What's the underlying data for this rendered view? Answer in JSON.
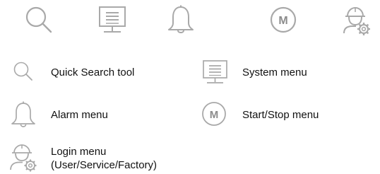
{
  "toolbar": {
    "icons": [
      "search-icon",
      "system-menu-icon",
      "alarm-bell-icon",
      "start-stop-m-icon",
      "login-user-gear-icon"
    ],
    "m_glyph": "M"
  },
  "legend": {
    "quick_search": "Quick Search tool",
    "system_menu": "System menu",
    "alarm_menu": "Alarm menu",
    "start_stop_menu": "Start/Stop menu",
    "login_menu_line1": "Login menu",
    "login_menu_line2": "(User/Service/Factory)",
    "m_glyph": "M"
  },
  "colors": {
    "icon_gray": "#a9a9a9",
    "text": "#111111"
  }
}
